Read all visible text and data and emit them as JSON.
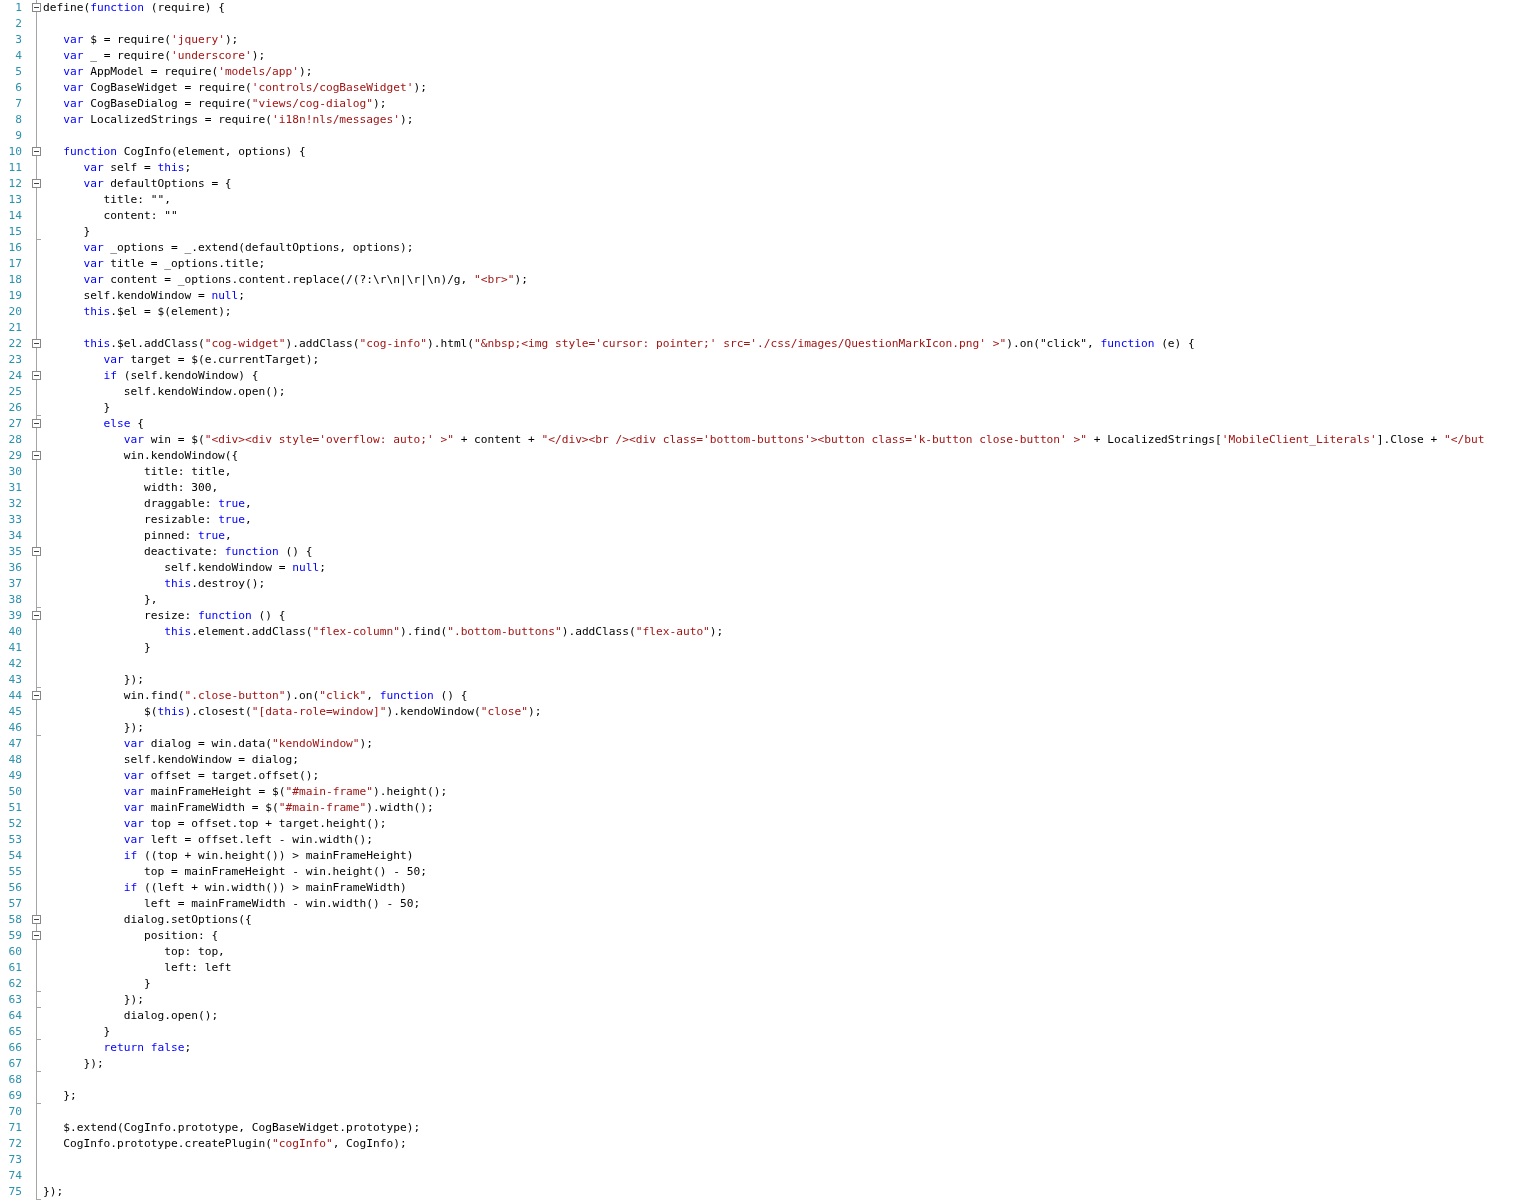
{
  "editor": {
    "lines": [
      {
        "number": "1",
        "collapsible": true,
        "block_end": false,
        "tokens": [
          {
            "kind": "plain",
            "text": "define("
          },
          {
            "kind": "keyword",
            "text": "function"
          },
          {
            "kind": "plain",
            "text": " (require) {"
          }
        ]
      },
      {
        "number": "2",
        "collapsible": false,
        "block_end": false
      },
      {
        "number": "3",
        "collapsible": false,
        "block_end": false,
        "tokens": [
          {
            "kind": "keyword",
            "text": "   var"
          },
          {
            "kind": "plain",
            "text": " $ = require("
          },
          {
            "kind": "string",
            "text": "'jquery'"
          },
          {
            "kind": "plain",
            "text": ");"
          }
        ]
      },
      {
        "number": "4",
        "collapsible": false,
        "block_end": false,
        "tokens": [
          {
            "kind": "keyword",
            "text": "   var"
          },
          {
            "kind": "plain",
            "text": " _ = require("
          },
          {
            "kind": "string",
            "text": "'underscore'"
          },
          {
            "kind": "plain",
            "text": ");"
          }
        ]
      },
      {
        "number": "5",
        "collapsible": false,
        "block_end": false,
        "tokens": [
          {
            "kind": "keyword",
            "text": "   var"
          },
          {
            "kind": "plain",
            "text": " AppModel = require("
          },
          {
            "kind": "string",
            "text": "'models/app'"
          },
          {
            "kind": "plain",
            "text": ");"
          }
        ]
      },
      {
        "number": "6",
        "collapsible": false,
        "block_end": false,
        "tokens": [
          {
            "kind": "keyword",
            "text": "   var"
          },
          {
            "kind": "plain",
            "text": " CogBaseWidget = require("
          },
          {
            "kind": "string",
            "text": "'controls/cogBaseWidget'"
          },
          {
            "kind": "plain",
            "text": ");"
          }
        ]
      },
      {
        "number": "7",
        "collapsible": false,
        "block_end": false,
        "tokens": [
          {
            "kind": "keyword",
            "text": "   var"
          },
          {
            "kind": "plain",
            "text": " CogBaseDialog = require("
          },
          {
            "kind": "string",
            "text": "\"views/cog-dialog\""
          },
          {
            "kind": "plain",
            "text": ");"
          }
        ]
      },
      {
        "number": "8",
        "collapsible": false,
        "block_end": false,
        "tokens": [
          {
            "kind": "keyword",
            "text": "   var"
          },
          {
            "kind": "plain",
            "text": " LocalizedStrings = require("
          },
          {
            "kind": "string",
            "text": "'i18n!nls/messages'"
          },
          {
            "kind": "plain",
            "text": ");"
          }
        ]
      },
      {
        "number": "9",
        "collapsible": false,
        "block_end": false
      },
      {
        "number": "10",
        "collapsible": true,
        "block_end": false,
        "tokens": [
          {
            "kind": "keyword",
            "text": "   function"
          },
          {
            "kind": "plain",
            "text": " CogInfo(element, options) {"
          }
        ]
      },
      {
        "number": "11",
        "collapsible": false,
        "block_end": false,
        "tokens": [
          {
            "kind": "keyword",
            "text": "      var"
          },
          {
            "kind": "plain",
            "text": " self = "
          },
          {
            "kind": "keyword",
            "text": "this"
          },
          {
            "kind": "plain",
            "text": ";"
          }
        ]
      },
      {
        "number": "12",
        "collapsible": true,
        "block_end": false,
        "tokens": [
          {
            "kind": "keyword",
            "text": "      var"
          },
          {
            "kind": "plain",
            "text": " defaultOptions = {"
          }
        ]
      },
      {
        "number": "13",
        "collapsible": false,
        "block_end": false,
        "tokens": [
          {
            "kind": "plain",
            "text": "         title: \"\","
          }
        ]
      },
      {
        "number": "14",
        "collapsible": false,
        "block_end": false,
        "tokens": [
          {
            "kind": "plain",
            "text": "         content: \"\""
          }
        ]
      },
      {
        "number": "15",
        "collapsible": false,
        "block_end": true,
        "tokens": [
          {
            "kind": "plain",
            "text": "      }"
          }
        ]
      },
      {
        "number": "16",
        "collapsible": false,
        "block_end": false,
        "tokens": [
          {
            "kind": "keyword",
            "text": "      var"
          },
          {
            "kind": "plain",
            "text": " _options = _.extend(defaultOptions, options);"
          }
        ]
      },
      {
        "number": "17",
        "collapsible": false,
        "block_end": false,
        "tokens": [
          {
            "kind": "keyword",
            "text": "      var"
          },
          {
            "kind": "plain",
            "text": " title = _options.title;"
          }
        ]
      },
      {
        "number": "18",
        "collapsible": false,
        "block_end": false,
        "tokens": [
          {
            "kind": "keyword",
            "text": "      var"
          },
          {
            "kind": "plain",
            "text": " content = _options.content.replace(/(?:\\r\\n|\\r|\\n)/g, "
          },
          {
            "kind": "string",
            "text": "\"<br>\""
          },
          {
            "kind": "plain",
            "text": ");"
          }
        ]
      },
      {
        "number": "19",
        "collapsible": false,
        "block_end": false,
        "tokens": [
          {
            "kind": "plain",
            "text": "      self.kendoWindow = "
          },
          {
            "kind": "keyword",
            "text": "null"
          },
          {
            "kind": "plain",
            "text": ";"
          }
        ]
      },
      {
        "number": "20",
        "collapsible": false,
        "block_end": false,
        "tokens": [
          {
            "kind": "keyword",
            "text": "      this"
          },
          {
            "kind": "plain",
            "text": ".$el = $(element);"
          }
        ]
      },
      {
        "number": "21",
        "collapsible": false,
        "block_end": false
      },
      {
        "number": "22",
        "collapsible": true,
        "block_end": false,
        "tokens": [
          {
            "kind": "keyword",
            "text": "      this"
          },
          {
            "kind": "plain",
            "text": ".$el.addClass("
          },
          {
            "kind": "string",
            "text": "\"cog-widget\""
          },
          {
            "kind": "plain",
            "text": ").addClass("
          },
          {
            "kind": "string",
            "text": "\"cog-info\""
          },
          {
            "kind": "plain",
            "text": ").html("
          },
          {
            "kind": "string",
            "text": "\"&nbsp;<img style='cursor: pointer;' src='./css/images/QuestionMarkIcon.png' >\""
          },
          {
            "kind": "plain",
            "text": ").on(\"click\", "
          },
          {
            "kind": "keyword",
            "text": "function"
          },
          {
            "kind": "plain",
            "text": " (e) {"
          }
        ]
      },
      {
        "number": "23",
        "collapsible": false,
        "block_end": false,
        "tokens": [
          {
            "kind": "keyword",
            "text": "         var"
          },
          {
            "kind": "plain",
            "text": " target = $(e.currentTarget);"
          }
        ]
      },
      {
        "number": "24",
        "collapsible": true,
        "block_end": false,
        "tokens": [
          {
            "kind": "keyword",
            "text": "         if"
          },
          {
            "kind": "plain",
            "text": " (self.kendoWindow) {"
          }
        ]
      },
      {
        "number": "25",
        "collapsible": false,
        "block_end": false,
        "tokens": [
          {
            "kind": "plain",
            "text": "            self.kendoWindow.open();"
          }
        ]
      },
      {
        "number": "26",
        "collapsible": false,
        "block_end": true,
        "tokens": [
          {
            "kind": "plain",
            "text": "         }"
          }
        ]
      },
      {
        "number": "27",
        "collapsible": true,
        "block_end": false,
        "tokens": [
          {
            "kind": "keyword",
            "text": "         else"
          },
          {
            "kind": "plain",
            "text": " {"
          }
        ]
      },
      {
        "number": "28",
        "collapsible": false,
        "block_end": false,
        "tokens": [
          {
            "kind": "keyword",
            "text": "            var"
          },
          {
            "kind": "plain",
            "text": " win = $("
          },
          {
            "kind": "string",
            "text": "\"<div><div style='overflow: auto;' >\""
          },
          {
            "kind": "plain",
            "text": " + content + "
          },
          {
            "kind": "string",
            "text": "\"</div><br /><div class='bottom-buttons'><button class='k-button close-button' >\""
          },
          {
            "kind": "plain",
            "text": " + LocalizedStrings["
          },
          {
            "kind": "string",
            "text": "'MobileClient_Literals'"
          },
          {
            "kind": "plain",
            "text": "].Close + "
          },
          {
            "kind": "string",
            "text": "\"</but"
          }
        ]
      },
      {
        "number": "29",
        "collapsible": true,
        "block_end": false,
        "tokens": [
          {
            "kind": "plain",
            "text": "            win.kendoWindow({"
          }
        ]
      },
      {
        "number": "30",
        "collapsible": false,
        "block_end": false,
        "tokens": [
          {
            "kind": "plain",
            "text": "               title: title,"
          }
        ]
      },
      {
        "number": "31",
        "collapsible": false,
        "block_end": false,
        "tokens": [
          {
            "kind": "plain",
            "text": "               width: 300,"
          }
        ]
      },
      {
        "number": "32",
        "collapsible": false,
        "block_end": false,
        "tokens": [
          {
            "kind": "plain",
            "text": "               draggable: "
          },
          {
            "kind": "keyword",
            "text": "true"
          },
          {
            "kind": "plain",
            "text": ","
          }
        ]
      },
      {
        "number": "33",
        "collapsible": false,
        "block_end": false,
        "tokens": [
          {
            "kind": "plain",
            "text": "               resizable: "
          },
          {
            "kind": "keyword",
            "text": "true"
          },
          {
            "kind": "plain",
            "text": ","
          }
        ]
      },
      {
        "number": "34",
        "collapsible": false,
        "block_end": false,
        "tokens": [
          {
            "kind": "plain",
            "text": "               pinned: "
          },
          {
            "kind": "keyword",
            "text": "true"
          },
          {
            "kind": "plain",
            "text": ","
          }
        ]
      },
      {
        "number": "35",
        "collapsible": true,
        "block_end": false,
        "tokens": [
          {
            "kind": "plain",
            "text": "               deactivate: "
          },
          {
            "kind": "keyword",
            "text": "function"
          },
          {
            "kind": "plain",
            "text": " () {"
          }
        ]
      },
      {
        "number": "36",
        "collapsible": false,
        "block_end": false,
        "tokens": [
          {
            "kind": "plain",
            "text": "                  self.kendoWindow = "
          },
          {
            "kind": "keyword",
            "text": "null"
          },
          {
            "kind": "plain",
            "text": ";"
          }
        ]
      },
      {
        "number": "37",
        "collapsible": false,
        "block_end": false,
        "tokens": [
          {
            "kind": "keyword",
            "text": "                  this"
          },
          {
            "kind": "plain",
            "text": ".destroy();"
          }
        ]
      },
      {
        "number": "38",
        "collapsible": false,
        "block_end": true,
        "tokens": [
          {
            "kind": "plain",
            "text": "               },"
          }
        ]
      },
      {
        "number": "39",
        "collapsible": true,
        "block_end": false,
        "tokens": [
          {
            "kind": "plain",
            "text": "               resize: "
          },
          {
            "kind": "keyword",
            "text": "function"
          },
          {
            "kind": "plain",
            "text": " () {"
          }
        ]
      },
      {
        "number": "40",
        "collapsible": false,
        "block_end": false,
        "tokens": [
          {
            "kind": "keyword",
            "text": "                  this"
          },
          {
            "kind": "plain",
            "text": ".element.addClass("
          },
          {
            "kind": "string",
            "text": "\"flex-column\""
          },
          {
            "kind": "plain",
            "text": ").find("
          },
          {
            "kind": "string",
            "text": "\".bottom-buttons\""
          },
          {
            "kind": "plain",
            "text": ").addClass("
          },
          {
            "kind": "string",
            "text": "\"flex-auto\""
          },
          {
            "kind": "plain",
            "text": ");"
          }
        ]
      },
      {
        "number": "41",
        "collapsible": false,
        "block_end": false,
        "tokens": [
          {
            "kind": "plain",
            "text": "               }"
          }
        ]
      },
      {
        "number": "42",
        "collapsible": false,
        "block_end": false
      },
      {
        "number": "43",
        "collapsible": false,
        "block_end": true,
        "tokens": [
          {
            "kind": "plain",
            "text": "            });"
          }
        ]
      },
      {
        "number": "44",
        "collapsible": true,
        "block_end": false,
        "tokens": [
          {
            "kind": "plain",
            "text": "            win.find("
          },
          {
            "kind": "string",
            "text": "\".close-button\""
          },
          {
            "kind": "plain",
            "text": ").on("
          },
          {
            "kind": "string",
            "text": "\"click\""
          },
          {
            "kind": "plain",
            "text": ", "
          },
          {
            "kind": "keyword",
            "text": "function"
          },
          {
            "kind": "plain",
            "text": " () {"
          }
        ]
      },
      {
        "number": "45",
        "collapsible": false,
        "block_end": false,
        "tokens": [
          {
            "kind": "plain",
            "text": "               $("
          },
          {
            "kind": "keyword",
            "text": "this"
          },
          {
            "kind": "plain",
            "text": ").closest("
          },
          {
            "kind": "string",
            "text": "\"[data-role=window]\""
          },
          {
            "kind": "plain",
            "text": ").kendoWindow("
          },
          {
            "kind": "string",
            "text": "\"close\""
          },
          {
            "kind": "plain",
            "text": ");"
          }
        ]
      },
      {
        "number": "46",
        "collapsible": false,
        "block_end": true,
        "tokens": [
          {
            "kind": "plain",
            "text": "            });"
          }
        ]
      },
      {
        "number": "47",
        "collapsible": false,
        "block_end": false,
        "tokens": [
          {
            "kind": "keyword",
            "text": "            var"
          },
          {
            "kind": "plain",
            "text": " dialog = win.data("
          },
          {
            "kind": "string",
            "text": "\"kendoWindow\""
          },
          {
            "kind": "plain",
            "text": ");"
          }
        ]
      },
      {
        "number": "48",
        "collapsible": false,
        "block_end": false,
        "tokens": [
          {
            "kind": "plain",
            "text": "            self.kendoWindow = dialog;"
          }
        ]
      },
      {
        "number": "49",
        "collapsible": false,
        "block_end": false,
        "tokens": [
          {
            "kind": "keyword",
            "text": "            var"
          },
          {
            "kind": "plain",
            "text": " offset = target.offset();"
          }
        ]
      },
      {
        "number": "50",
        "collapsible": false,
        "block_end": false,
        "tokens": [
          {
            "kind": "keyword",
            "text": "            var"
          },
          {
            "kind": "plain",
            "text": " mainFrameHeight = $("
          },
          {
            "kind": "string",
            "text": "\"#main-frame\""
          },
          {
            "kind": "plain",
            "text": ").height();"
          }
        ]
      },
      {
        "number": "51",
        "collapsible": false,
        "block_end": false,
        "tokens": [
          {
            "kind": "keyword",
            "text": "            var"
          },
          {
            "kind": "plain",
            "text": " mainFrameWidth = $("
          },
          {
            "kind": "string",
            "text": "\"#main-frame\""
          },
          {
            "kind": "plain",
            "text": ").width();"
          }
        ]
      },
      {
        "number": "52",
        "collapsible": false,
        "block_end": false,
        "tokens": [
          {
            "kind": "keyword",
            "text": "            var"
          },
          {
            "kind": "plain",
            "text": " top = offset.top + target.height();"
          }
        ]
      },
      {
        "number": "53",
        "collapsible": false,
        "block_end": false,
        "tokens": [
          {
            "kind": "keyword",
            "text": "            var"
          },
          {
            "kind": "plain",
            "text": " left = offset.left - win.width();"
          }
        ]
      },
      {
        "number": "54",
        "collapsible": false,
        "block_end": false,
        "tokens": [
          {
            "kind": "keyword",
            "text": "            if"
          },
          {
            "kind": "plain",
            "text": " ((top + win.height()) > mainFrameHeight)"
          }
        ]
      },
      {
        "number": "55",
        "collapsible": false,
        "block_end": false,
        "tokens": [
          {
            "kind": "plain",
            "text": "               top = mainFrameHeight - win.height() - 50;"
          }
        ]
      },
      {
        "number": "56",
        "collapsible": false,
        "block_end": false,
        "tokens": [
          {
            "kind": "keyword",
            "text": "            if"
          },
          {
            "kind": "plain",
            "text": " ((left + win.width()) > mainFrameWidth)"
          }
        ]
      },
      {
        "number": "57",
        "collapsible": false,
        "block_end": false,
        "tokens": [
          {
            "kind": "plain",
            "text": "               left = mainFrameWidth - win.width() - 50;"
          }
        ]
      },
      {
        "number": "58",
        "collapsible": true,
        "block_end": false,
        "tokens": [
          {
            "kind": "plain",
            "text": "            dialog.setOptions({"
          }
        ]
      },
      {
        "number": "59",
        "collapsible": true,
        "block_end": false,
        "tokens": [
          {
            "kind": "plain",
            "text": "               position: {"
          }
        ]
      },
      {
        "number": "60",
        "collapsible": false,
        "block_end": false,
        "tokens": [
          {
            "kind": "plain",
            "text": "                  top: top,"
          }
        ]
      },
      {
        "number": "61",
        "collapsible": false,
        "block_end": false,
        "tokens": [
          {
            "kind": "plain",
            "text": "                  left: left"
          }
        ]
      },
      {
        "number": "62",
        "collapsible": false,
        "block_end": true,
        "tokens": [
          {
            "kind": "plain",
            "text": "               }"
          }
        ]
      },
      {
        "number": "63",
        "collapsible": false,
        "block_end": true,
        "tokens": [
          {
            "kind": "plain",
            "text": "            });"
          }
        ]
      },
      {
        "number": "64",
        "collapsible": false,
        "block_end": false,
        "tokens": [
          {
            "kind": "plain",
            "text": "            dialog.open();"
          }
        ]
      },
      {
        "number": "65",
        "collapsible": false,
        "block_end": true,
        "tokens": [
          {
            "kind": "plain",
            "text": "         }"
          }
        ]
      },
      {
        "number": "66",
        "collapsible": false,
        "block_end": false,
        "tokens": [
          {
            "kind": "keyword",
            "text": "         return false"
          },
          {
            "kind": "plain",
            "text": ";"
          }
        ]
      },
      {
        "number": "67",
        "collapsible": false,
        "block_end": true,
        "tokens": [
          {
            "kind": "plain",
            "text": "      });"
          }
        ]
      },
      {
        "number": "68",
        "collapsible": false,
        "block_end": false
      },
      {
        "number": "69",
        "collapsible": false,
        "block_end": true,
        "tokens": [
          {
            "kind": "plain",
            "text": "   };"
          }
        ]
      },
      {
        "number": "70",
        "collapsible": false,
        "block_end": false
      },
      {
        "number": "71",
        "collapsible": false,
        "block_end": false,
        "tokens": [
          {
            "kind": "plain",
            "text": "   $.extend(CogInfo.prototype, CogBaseWidget.prototype);"
          }
        ]
      },
      {
        "number": "72",
        "collapsible": false,
        "block_end": false,
        "tokens": [
          {
            "kind": "plain",
            "text": "   CogInfo.prototype.createPlugin("
          },
          {
            "kind": "string",
            "text": "\"cogInfo\""
          },
          {
            "kind": "plain",
            "text": ", CogInfo);"
          }
        ]
      },
      {
        "number": "73",
        "collapsible": false,
        "block_end": false
      },
      {
        "number": "74",
        "collapsible": false,
        "block_end": false
      },
      {
        "number": "75",
        "collapsible": false,
        "block_end": true,
        "tokens": [
          {
            "kind": "plain",
            "text": "});"
          }
        ]
      }
    ]
  }
}
